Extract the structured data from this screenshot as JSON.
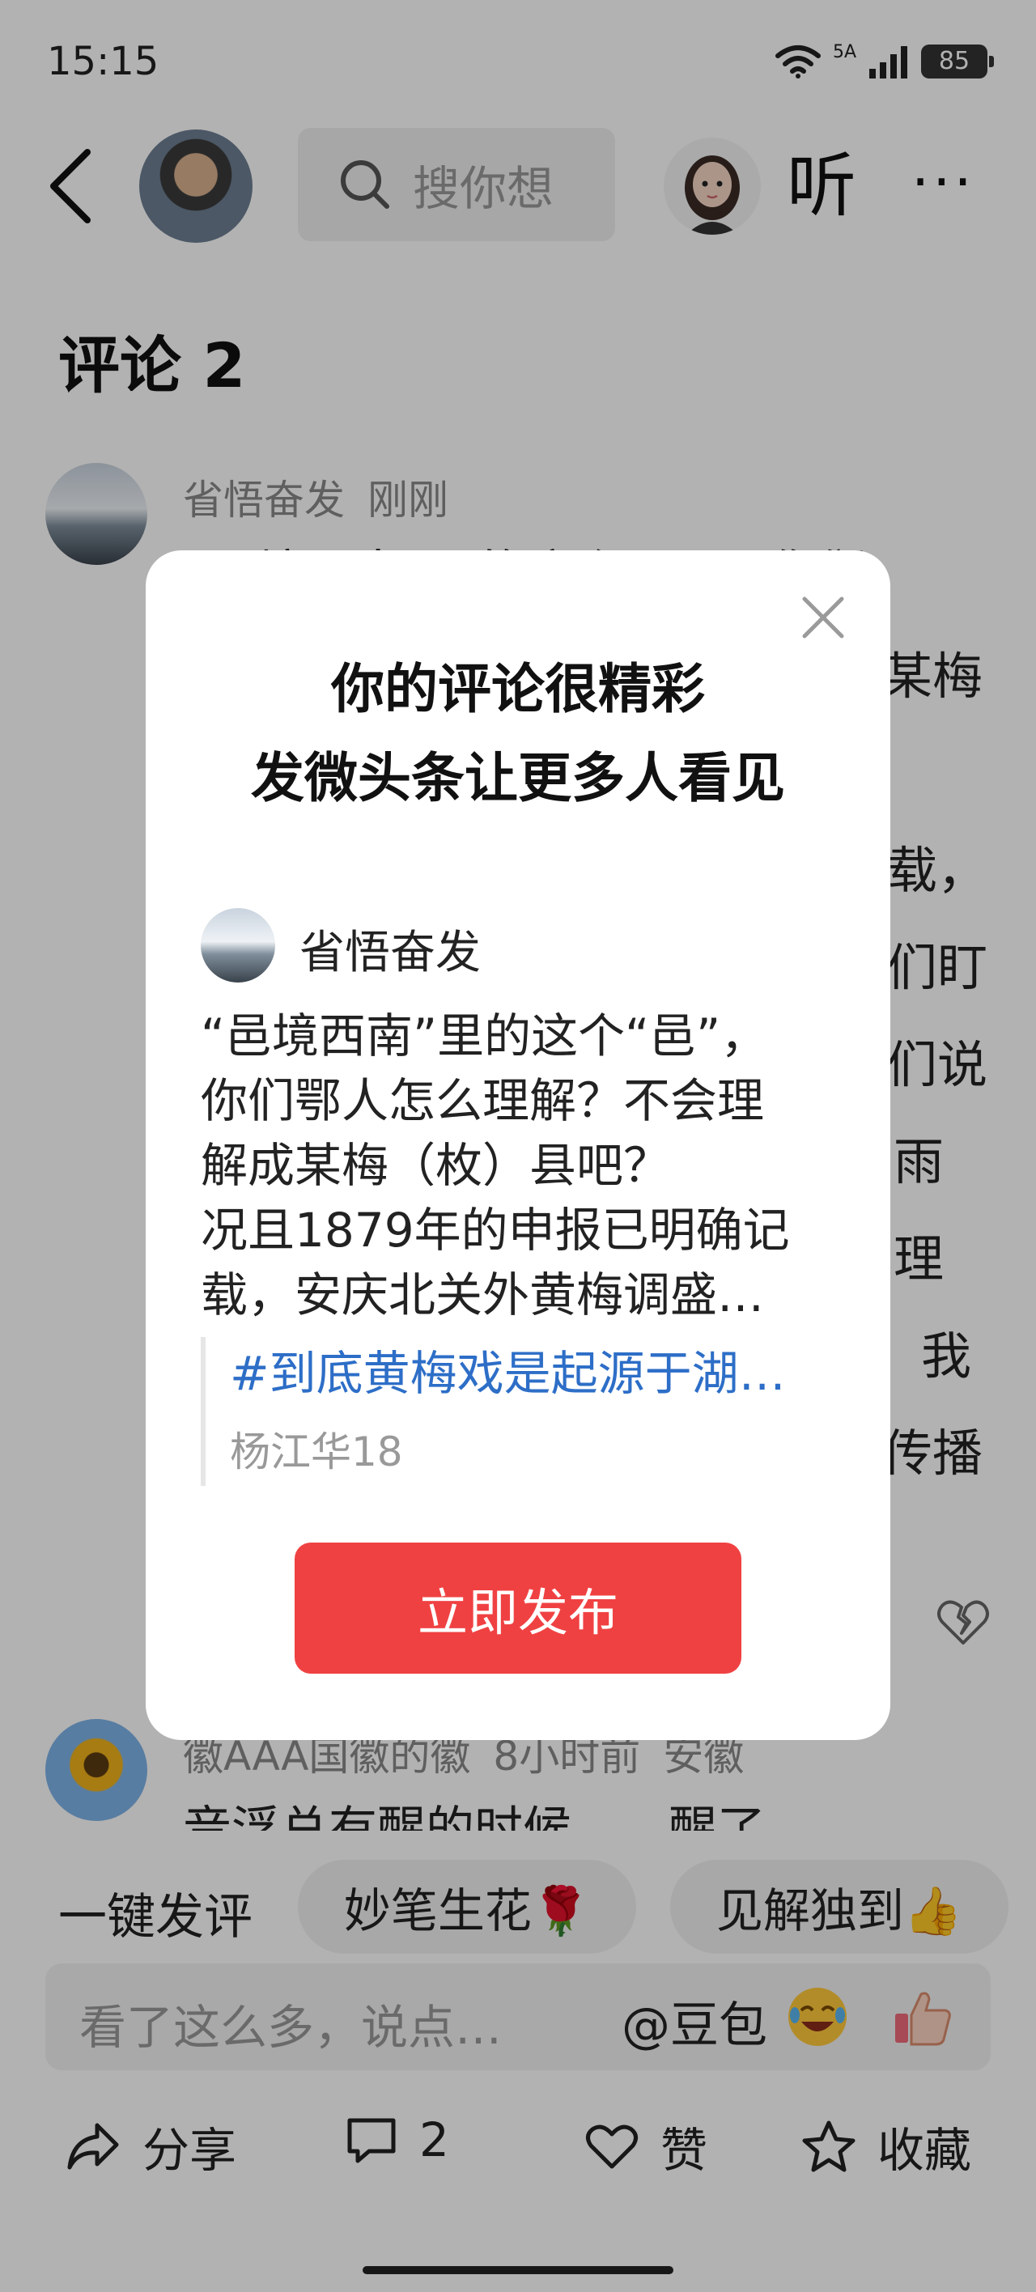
{
  "status": {
    "time": "15:15",
    "network": "5A",
    "battery": "85"
  },
  "nav": {
    "search_placeholder": "搜你想",
    "listen_label": "听",
    "more_label": "···"
  },
  "comments": {
    "title": "评论 2",
    "items": [
      {
        "author": "省悟奋发",
        "time": "刚刚",
        "visible_lines": [
          "“邑境西南”里的这个“邑”，你们"
        ],
        "background_fragments": [
          "某梅",
          "载，",
          "们盯",
          "们说",
          "雨",
          "理",
          "我",
          "传播"
        ]
      },
      {
        "author": "徽AAA国徽的徽",
        "time": "8小时前",
        "location": "安徽",
        "snippet": "音浮总有醒的时候……醒了……"
      }
    ]
  },
  "quick_reply": {
    "label": "一键发评",
    "chips": [
      "妙笔生花🌹",
      "见解独到👍"
    ]
  },
  "input": {
    "placeholder": "看了这么多，说点…",
    "mention": "@豆包"
  },
  "actions": {
    "share": "分享",
    "comment_count": "2",
    "like": "赞",
    "favorite": "收藏"
  },
  "modal": {
    "title_line1": "你的评论很精彩",
    "title_line2": "发微头条让更多人看见",
    "author": "省悟奋发",
    "text_lines": [
      "“邑境西南”里的这个“邑”，",
      "你们鄂人怎么理解？不会理",
      "解成某梅（枚）县吧？",
      "况且1879年的申报已明确记",
      "载，安庆北关外黄梅调盛…"
    ],
    "topic": "#到底黄梅戏是起源于湖…",
    "source": "杨江华18",
    "publish_label": "立即发布"
  }
}
